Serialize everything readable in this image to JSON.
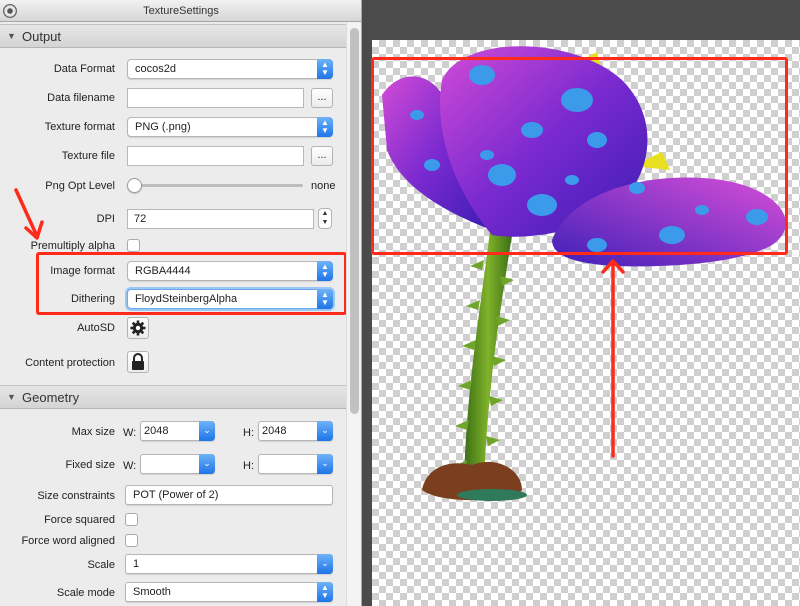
{
  "window": {
    "title": "TextureSettings"
  },
  "output": {
    "header": "Output",
    "data_format": {
      "label": "Data Format",
      "value": "cocos2d"
    },
    "data_filename": {
      "label": "Data filename",
      "value": "",
      "button": "..."
    },
    "texture_format": {
      "label": "Texture format",
      "value": "PNG (.png)"
    },
    "texture_file": {
      "label": "Texture file",
      "value": "",
      "button": "..."
    },
    "png_opt_level": {
      "label": "Png Opt Level",
      "value": "none"
    },
    "dpi": {
      "label": "DPI",
      "value": "72"
    },
    "premultiply_alpha": {
      "label": "Premultiply alpha",
      "checked": false
    },
    "image_format": {
      "label": "Image format",
      "value": "RGBA4444"
    },
    "dithering": {
      "label": "Dithering",
      "value": "FloydSteinbergAlpha"
    },
    "autosd": {
      "label": "AutoSD",
      "icon": "gear-icon"
    },
    "content_protection": {
      "label": "Content protection",
      "icon": "lock-icon"
    }
  },
  "geometry": {
    "header": "Geometry",
    "max_size": {
      "label": "Max size",
      "w_label": "W:",
      "w_value": "2048",
      "h_label": "H:",
      "h_value": "2048"
    },
    "fixed_size": {
      "label": "Fixed size",
      "w_label": "W:",
      "w_value": "",
      "h_label": "H:",
      "h_value": ""
    },
    "size_constraints": {
      "label": "Size constraints",
      "value": "POT (Power of 2)"
    },
    "force_squared": {
      "label": "Force squared",
      "checked": false
    },
    "force_word_aligned": {
      "label": "Force word aligned",
      "checked": false
    },
    "scale": {
      "label": "Scale",
      "value": "1"
    },
    "scale_mode": {
      "label": "Scale mode",
      "value": "Smooth"
    }
  },
  "annotation_color": "#ff2a1a"
}
